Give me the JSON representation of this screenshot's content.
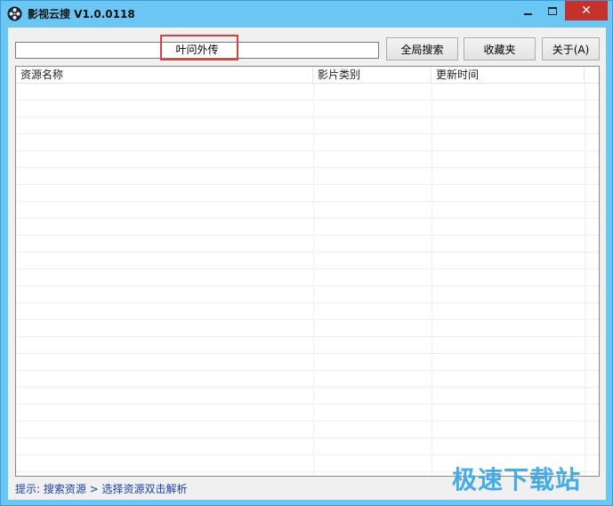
{
  "window": {
    "title": "影视云搜 V1.0.0118",
    "close_glyph": "✕"
  },
  "search": {
    "value": "叶问外传"
  },
  "toolbar": {
    "global_search_label": "全局搜索",
    "favorites_label": "收藏夹",
    "about_label": "关于(A)"
  },
  "list": {
    "columns": [
      "资源名称",
      "影片类别",
      "更新时间"
    ],
    "rows": []
  },
  "status": {
    "tip": "提示: 搜索资源 > 选择资源双击解析"
  },
  "watermark": {
    "text": "极速下载站"
  },
  "colors": {
    "titlebar": "#6cc6f4",
    "close_button": "#c7312b",
    "highlight": "#d9413a",
    "status_text": "#1a3ea8",
    "watermark": "#3da9e8"
  },
  "icons": {
    "app": "film-reel-icon",
    "minimize": "minimize-icon",
    "maximize": "maximize-icon",
    "close": "close-icon"
  }
}
